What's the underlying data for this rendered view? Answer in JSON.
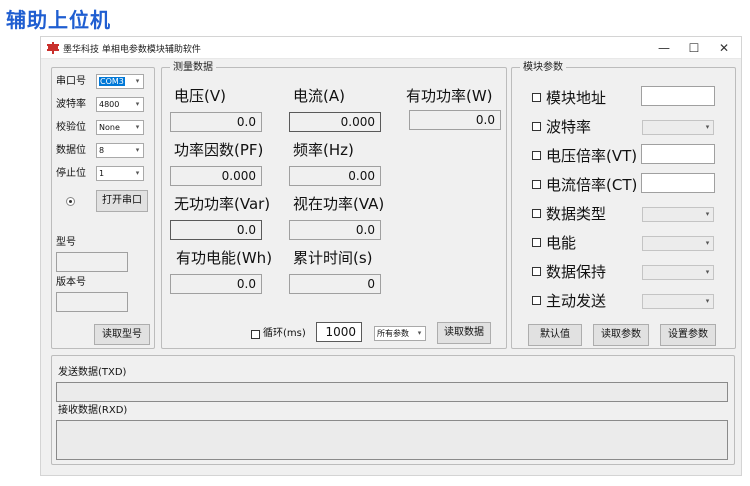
{
  "page_heading": "辅助上位机",
  "window": {
    "title": "墨华科技 单相电参数模块辅助软件",
    "controls": {
      "minimize": "—",
      "maximize": "☐",
      "close": "✕"
    }
  },
  "serial": {
    "port_label": "串口号",
    "port_value": "COM3",
    "baud_label": "波特率",
    "baud_value": "4800",
    "parity_label": "校验位",
    "parity_value": "None",
    "databits_label": "数据位",
    "databits_value": "8",
    "stopbits_label": "停止位",
    "stopbits_value": "1",
    "open_button": "打开串口",
    "model_label": "型号",
    "model_value": "",
    "version_label": "版本号",
    "version_value": "",
    "read_model_button": "读取型号"
  },
  "measure": {
    "title": "测量数据",
    "voltage_label": "电压(V)",
    "voltage_value": "0.0",
    "current_label": "电流(A)",
    "current_value": "0.000",
    "active_power_label": "有功功率(W)",
    "active_power_value": "0.0",
    "power_factor_label": "功率因数(PF)",
    "power_factor_value": "0.000",
    "frequency_label": "频率(Hz)",
    "frequency_value": "0.00",
    "reactive_power_label": "无功功率(Var)",
    "reactive_power_value": "0.0",
    "apparent_power_label": "视在功率(VA)",
    "apparent_power_value": "0.0",
    "energy_label": "有功电能(Wh)",
    "energy_value": "0.0",
    "cumulative_time_label": "累计时间(s)",
    "cumulative_time_value": "0",
    "loop_label": "循环(ms)",
    "loop_value": "1000",
    "param_select": "所有参数",
    "read_data_button": "读取数据"
  },
  "module": {
    "title": "模块参数",
    "address_label": "模块地址",
    "baud_label": "波特率",
    "vt_label": "电压倍率(VT)",
    "ct_label": "电流倍率(CT)",
    "data_type_label": "数据类型",
    "energy_label": "电能",
    "data_hold_label": "数据保持",
    "active_send_label": "主动发送",
    "default_button": "默认值",
    "read_params_button": "读取参数",
    "set_params_button": "设置参数"
  },
  "comm": {
    "txd_label": "发送数据(TXD)",
    "txd_value": "",
    "rxd_label": "接收数据(RXD)",
    "rxd_value": ""
  },
  "colors": {
    "heading": "#1f5ed1",
    "icon": "#c9302c",
    "selection": "#0078d7",
    "window_bg": "#f0f0f0"
  }
}
